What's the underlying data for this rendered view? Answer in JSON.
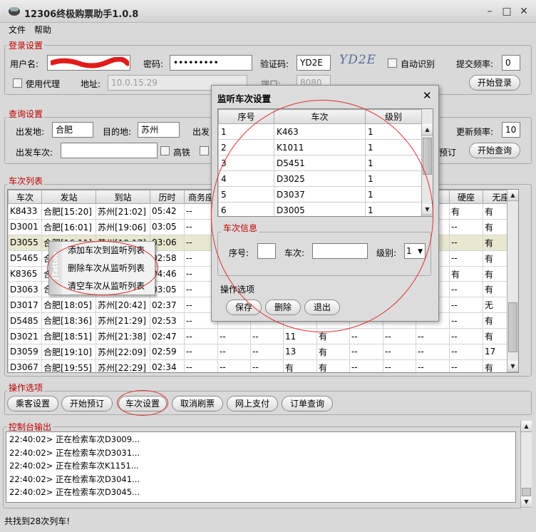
{
  "window": {
    "title": "12306终极购票助手1.0.8",
    "min": "–",
    "max": "□",
    "close": "✕"
  },
  "menu": {
    "file": "文件",
    "help": "帮助"
  },
  "login": {
    "legend": "登录设置",
    "username_label": "用户名:",
    "password_label": "密码:",
    "password_value": "•••••••••",
    "captcha_label": "验证码:",
    "captcha_value": "YD2E",
    "captcha_image_text": "YD2E",
    "auto_recognize": "自动识别",
    "submit_freq_label": "提交频率:",
    "submit_freq_value": "0",
    "use_proxy": "使用代理",
    "address_label": "地址:",
    "address_value": "10.0.15.29",
    "port_label": "端口:",
    "port_value": "8080",
    "login_button": "开始登录"
  },
  "query": {
    "legend": "查询设置",
    "from_label": "出发地:",
    "from_value": "合肥",
    "to_label": "目的地:",
    "to_value": "苏州",
    "date_label": "出发",
    "refresh_label": "更新频率:",
    "refresh_value": "10",
    "train_label": "出发车次:",
    "highspeed": "高铁",
    "book_label": "预订",
    "query_button": "开始查询"
  },
  "trains": {
    "legend": "车次列表",
    "columns": [
      "车次",
      "发站",
      "到站",
      "历时",
      "商务座",
      "",
      "",
      "",
      "",
      "",
      "",
      "",
      "硬座",
      "无座"
    ],
    "rows": [
      {
        "c": [
          "K8433",
          "合肥[15:20]",
          "苏州[21:02]",
          "05:42",
          "--",
          "",
          "",
          "",
          "",
          "",
          "",
          "",
          "有",
          "有"
        ]
      },
      {
        "c": [
          "D3001",
          "合肥[16:01]",
          "苏州[19:06]",
          "03:05",
          "--",
          "",
          "",
          "",
          "",
          "",
          "",
          "",
          "--",
          "有"
        ]
      },
      {
        "c": [
          "D3055",
          "合肥[16:11]",
          "苏州[19:17]",
          "03:06",
          "--",
          "",
          "",
          "",
          "",
          "",
          "",
          "",
          "--",
          "有"
        ]
      },
      {
        "c": [
          "D5465",
          "合肥[16:20]",
          "苏州[19:18]",
          "02:58",
          "--",
          "",
          "",
          "",
          "",
          "",
          "",
          "",
          "--",
          "有"
        ]
      },
      {
        "c": [
          "K8365",
          "合肥[16:40]",
          "苏州[21:26]",
          "04:46",
          "--",
          "",
          "",
          "",
          "",
          "",
          "",
          "",
          "有",
          "有"
        ]
      },
      {
        "c": [
          "D3063",
          "合肥[17:05]",
          "苏州[20:10]",
          "03:05",
          "--",
          "",
          "",
          "",
          "",
          "",
          "",
          "",
          "--",
          "有"
        ]
      },
      {
        "c": [
          "D3017",
          "合肥[18:05]",
          "苏州[20:42]",
          "02:37",
          "--",
          "",
          "",
          "",
          "",
          "",
          "",
          "",
          "--",
          "无"
        ]
      },
      {
        "c": [
          "D5485",
          "合肥[18:36]",
          "苏州[21:29]",
          "02:53",
          "--",
          "",
          "",
          "",
          "",
          "",
          "",
          "",
          "--",
          "有"
        ]
      },
      {
        "c": [
          "D3021",
          "合肥[18:51]",
          "苏州[21:38]",
          "02:47",
          "--",
          "--",
          "--",
          "11",
          "有",
          "--",
          "--",
          "--",
          "--",
          "有"
        ]
      },
      {
        "c": [
          "D3059",
          "合肥[19:10]",
          "苏州[22:09]",
          "02:59",
          "--",
          "--",
          "--",
          "13",
          "有",
          "--",
          "--",
          "--",
          "--",
          "17"
        ]
      },
      {
        "c": [
          "D3067",
          "合肥[19:55]",
          "苏州[22:29]",
          "02:34",
          "--",
          "--",
          "--",
          "有",
          "有",
          "--",
          "--",
          "--",
          "--",
          "有"
        ]
      }
    ]
  },
  "context_menu": {
    "side_text": "JTattoo",
    "items": [
      "添加车次到监听列表",
      "删除车次从监听列表",
      "清空车次从监听列表"
    ]
  },
  "dialog": {
    "title": "监听车次设置",
    "close": "✕",
    "columns": [
      "序号",
      "车次",
      "级别"
    ],
    "rows": [
      {
        "c": [
          "1",
          "K463",
          "1"
        ]
      },
      {
        "c": [
          "2",
          "K1011",
          "1"
        ]
      },
      {
        "c": [
          "3",
          "D5451",
          "1"
        ]
      },
      {
        "c": [
          "4",
          "D3025",
          "1"
        ]
      },
      {
        "c": [
          "5",
          "D3037",
          "1"
        ]
      },
      {
        "c": [
          "6",
          "D3005",
          "1"
        ]
      }
    ],
    "info_legend": "车次信息",
    "seq_label": "序号:",
    "train_label": "车次:",
    "level_label": "级别:",
    "level_value": "1",
    "ops_legend": "操作选项",
    "save": "保存",
    "delete": "删除",
    "exit": "退出"
  },
  "ops": {
    "legend": "操作选项",
    "buttons": [
      "乘客设置",
      "开始预订",
      "车次设置",
      "取消刷票",
      "网上支付",
      "订单查询"
    ]
  },
  "console": {
    "legend": "控制台输出",
    "lines": [
      "22:40:02> 正在检索车次D3009...",
      "22:40:02> 正在检索车次D3031...",
      "22:40:02> 正在检索车次K1151...",
      "22:40:02> 正在检索车次D3041...",
      "22:40:02> 正在检索车次D3045..."
    ]
  },
  "status": "共找到28次列车!",
  "colors": {
    "legend": "#c00000",
    "annotation": "#e03030",
    "selected_row": "#e7e8cf"
  }
}
